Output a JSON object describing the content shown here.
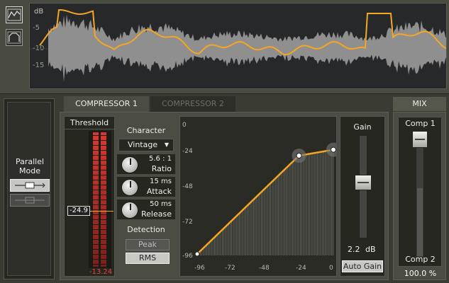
{
  "wave": {
    "scale_unit": "dB",
    "scale_ticks": [
      "-5",
      "-10",
      "-15"
    ],
    "icons": [
      "envelope-view-icon",
      "curve-view-icon"
    ]
  },
  "tabs": [
    {
      "label": "COMPRESSOR 1",
      "active": true
    },
    {
      "label": "COMPRESSOR 2",
      "active": false
    }
  ],
  "parallel": {
    "title": "Parallel Mode"
  },
  "threshold": {
    "title": "Threshold",
    "value": "-24.9",
    "meter_readout": "-13.24"
  },
  "character": {
    "title": "Character",
    "selected": "Vintage"
  },
  "ratio": {
    "value": "5.6 : 1",
    "label": "Ratio"
  },
  "attack": {
    "value": "15 ms",
    "label": "Attack"
  },
  "release": {
    "value": "50 ms",
    "label": "Release"
  },
  "detection": {
    "title": "Detection",
    "peak": "Peak",
    "rms": "RMS",
    "selected": "RMS"
  },
  "graph": {
    "y_ticks": [
      "0",
      "-24",
      "-48",
      "-72",
      "-96"
    ],
    "x_ticks": [
      "-96",
      "-72",
      "-48",
      "-24",
      "0"
    ]
  },
  "gain": {
    "title": "Gain",
    "value": "2.2",
    "unit": "dB",
    "auto_gain": "Auto Gain"
  },
  "mix": {
    "title": "MIX",
    "top_label": "Comp 1",
    "bottom_label": "Comp 2",
    "value": "100.0 %"
  },
  "colors": {
    "accent": "#f5a623",
    "meter_red": "#c0362c",
    "panel_bg": "#3a3c33"
  }
}
